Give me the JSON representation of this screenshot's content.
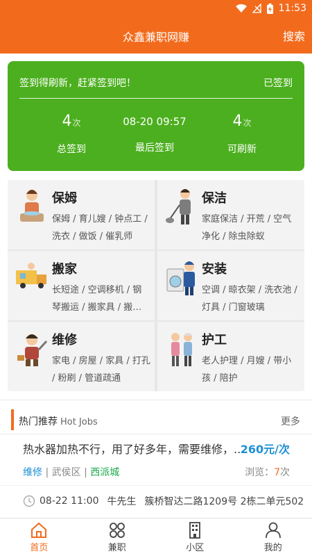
{
  "status_bar": {
    "time": "11:53",
    "battery_icon": "battery-charging-icon",
    "wifi_icon": "wifi-icon",
    "signal_icon": "no-signal-icon"
  },
  "header": {
    "title": "众鑫兼职网赚",
    "search_label": "搜索"
  },
  "checkin": {
    "prompt": "签到得刷新，赶紧签到吧！",
    "status": "已签到",
    "total": {
      "value": "4",
      "unit": "次",
      "label": "总签到"
    },
    "last": {
      "value": "08-20 09:57",
      "label": "最后签到"
    },
    "refresh": {
      "value": "4",
      "unit": "次",
      "label": "可刷新"
    }
  },
  "categories": [
    {
      "name": "保姆",
      "desc": "保姆 / 育儿嫂 / 钟点工 / 洗衣 / 做饭 / 催乳师",
      "icon": "nanny-illustration-icon"
    },
    {
      "name": "保洁",
      "desc": "家庭保洁 / 开荒 / 空气净化 / 除虫除蚁",
      "icon": "cleaning-illustration-icon"
    },
    {
      "name": "搬家",
      "desc": "长短途 / 空调移机 / 钢琴搬运 / 搬家具 / 搬…",
      "icon": "moving-truck-illustration-icon"
    },
    {
      "name": "安装",
      "desc": "空调 / 晾衣架 / 洗衣池 / 灯具 / 门窗玻璃",
      "icon": "installation-illustration-icon"
    },
    {
      "name": "维修",
      "desc": "家电 / 房屋 / 家具 / 打孔 / 粉刷 / 管道疏通",
      "icon": "repair-illustration-icon"
    },
    {
      "name": "护工",
      "desc": "老人护理 / 月嫂 / 带小孩 / 陪护",
      "icon": "caregiver-illustration-icon"
    }
  ],
  "hot": {
    "title": "热门推荐",
    "title_en": "Hot Jobs",
    "more": "更多"
  },
  "job": {
    "title": "热水器加热不行，用了好多年，需要维修，...",
    "price": "260元/次",
    "tag1": "维修",
    "sep1": " | ",
    "tag2": "武侯区",
    "sep2": " | ",
    "tag3": "西派城",
    "views_label": "浏览：",
    "views_count": "7",
    "views_unit": "次",
    "datetime": "08-22 11:00",
    "person": "牛先生",
    "address": "簇桥智达二路1209号 2栋二单元502"
  },
  "tabs": [
    {
      "label": "首页",
      "icon": "home-icon"
    },
    {
      "label": "兼职",
      "icon": "grid-icon"
    },
    {
      "label": "小区",
      "icon": "building-icon"
    },
    {
      "label": "我的",
      "icon": "user-icon"
    }
  ],
  "colors": {
    "brand": "#f26b1d",
    "checkin_green": "#4caf1f",
    "link_blue": "#1e90d4",
    "tag_green": "#19aa4a"
  }
}
